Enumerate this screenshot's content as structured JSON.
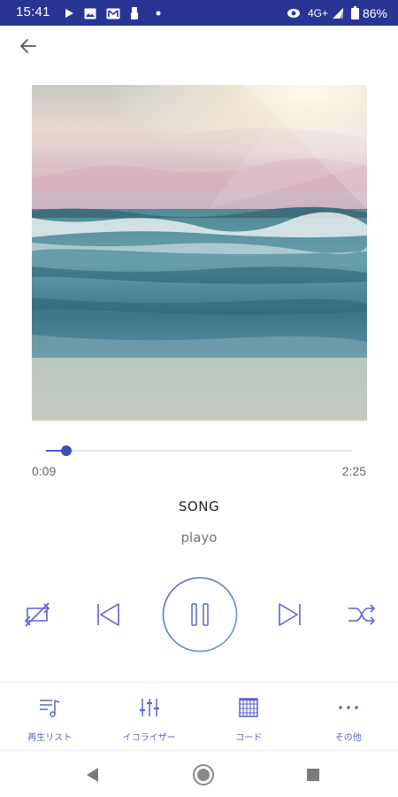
{
  "status_bar": {
    "time": "15:41",
    "network": "4G+",
    "battery": "86%",
    "icons": [
      "play-icon",
      "image-icon",
      "gmail-icon",
      "person-icon",
      "dot-icon",
      "eye-icon",
      "signal-icon",
      "battery-icon"
    ],
    "bg_color": "#283593"
  },
  "header": {
    "back_icon": "arrow-back-icon"
  },
  "album": {
    "alt": "album-artwork"
  },
  "player": {
    "progress": 0.067,
    "current_time": "0:09",
    "total_time": "2:25",
    "title": "SONG",
    "artist": "playo",
    "accent_color": "#3f51b5"
  },
  "controls": [
    "repeat-off-icon",
    "skip-previous-icon",
    "pause-icon",
    "skip-next-icon",
    "shuffle-icon"
  ],
  "tabs": [
    {
      "label": "再生リスト",
      "icon": "playlist-icon"
    },
    {
      "label": "イコライザー",
      "icon": "equalizer-icon"
    },
    {
      "label": "コード",
      "icon": "chord-grid-icon"
    },
    {
      "label": "その他",
      "icon": "more-icon"
    }
  ],
  "nav": [
    "back-triangle-icon",
    "home-circle-icon",
    "recents-square-icon"
  ]
}
